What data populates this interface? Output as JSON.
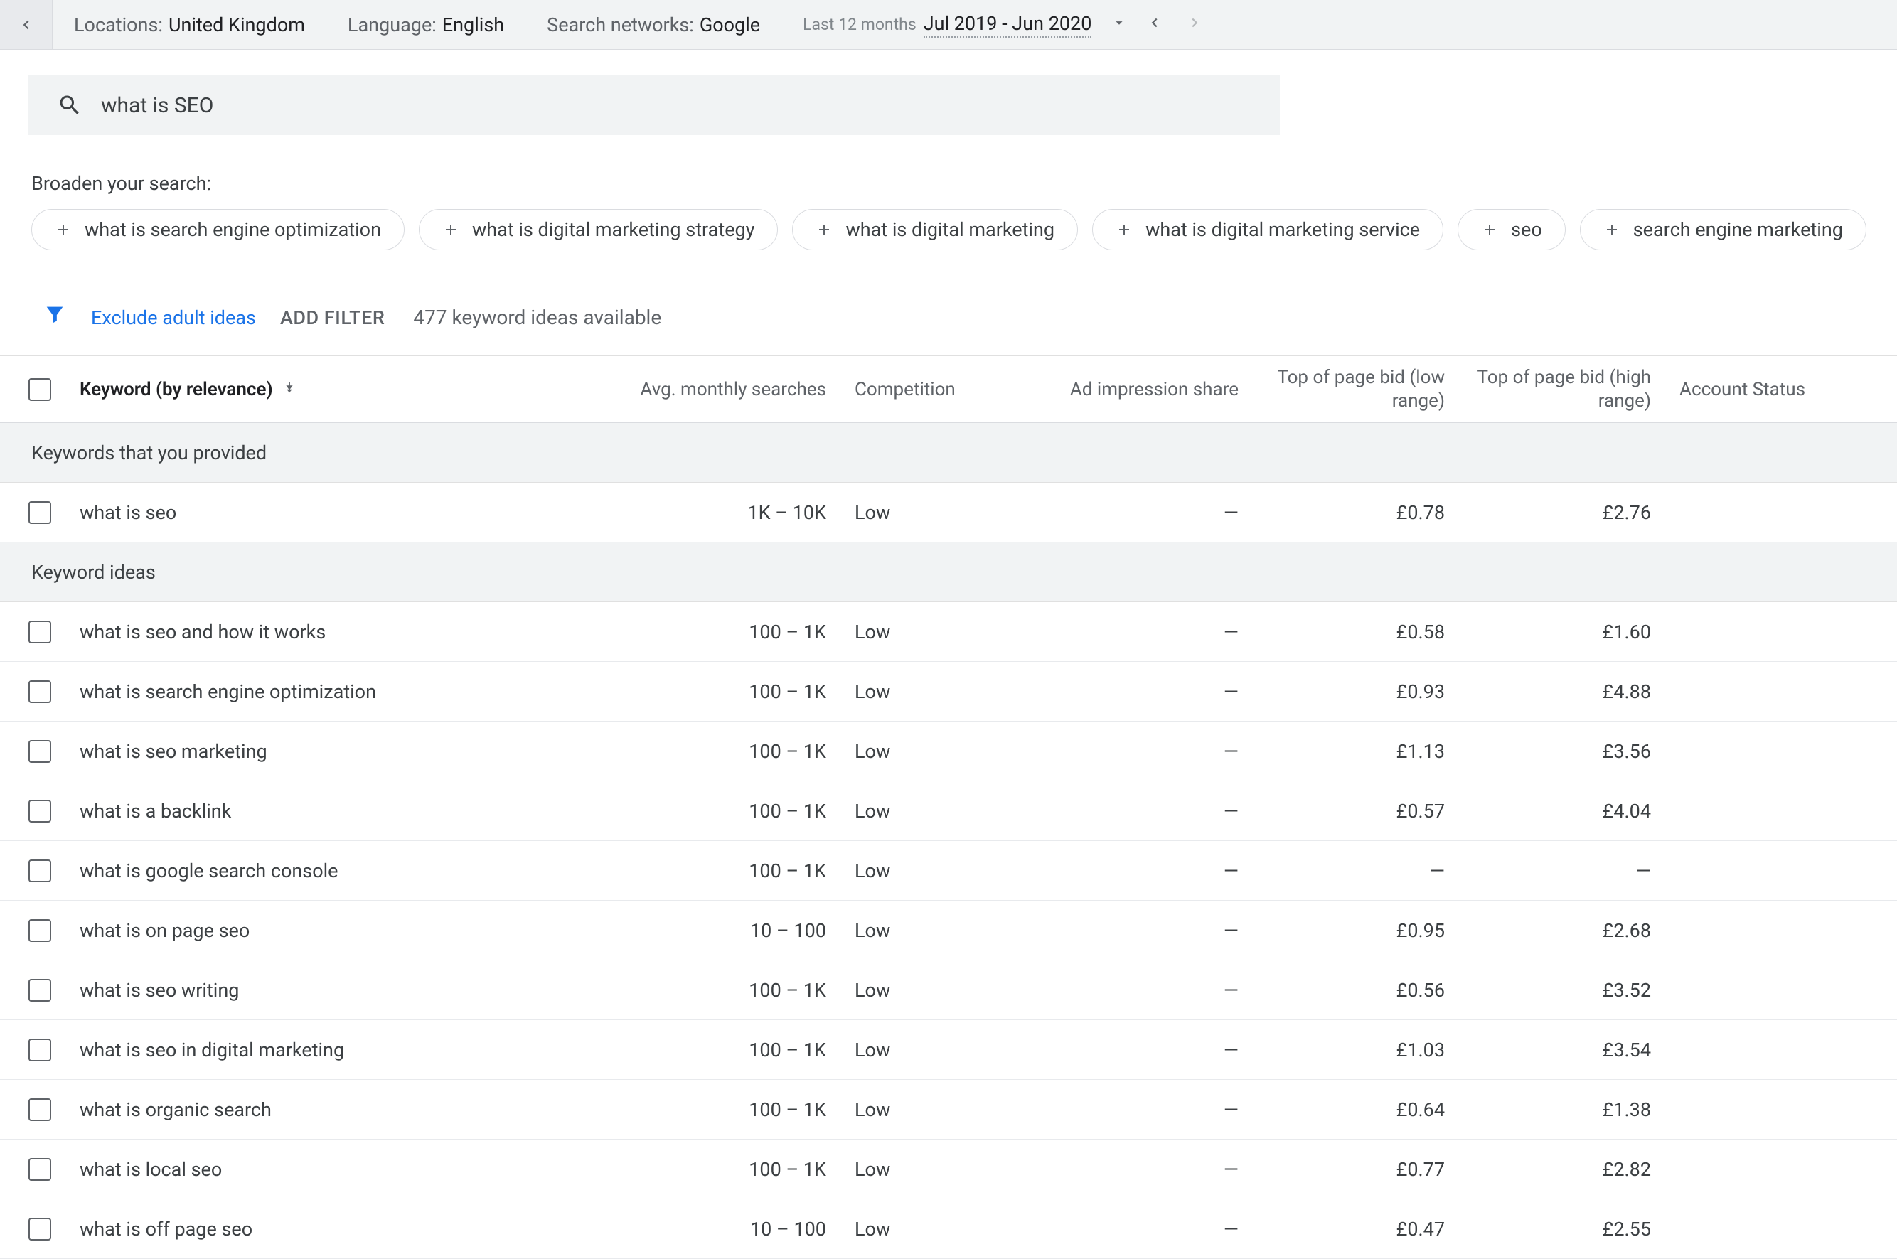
{
  "topbar": {
    "locations_label": "Locations:",
    "locations_value": "United Kingdom",
    "language_label": "Language:",
    "language_value": "English",
    "networks_label": "Search networks:",
    "networks_value": "Google",
    "date_small_label": "Last 12 months",
    "date_value": "Jul 2019 - Jun 2020"
  },
  "search": {
    "query": "what is SEO"
  },
  "broaden": {
    "label": "Broaden your search:",
    "chips": [
      "what is search engine optimization",
      "what is digital marketing strategy",
      "what is digital marketing",
      "what is digital marketing service",
      "seo",
      "search engine marketing"
    ]
  },
  "filters": {
    "exclude_link": "Exclude adult ideas",
    "add_filter": "ADD FILTER",
    "idea_count": "477 keyword ideas available"
  },
  "columns": {
    "keyword": "Keyword (by relevance)",
    "searches": "Avg. monthly searches",
    "competition": "Competition",
    "impression": "Ad impression share",
    "bid_low": "Top of page bid (low range)",
    "bid_high": "Top of page bid (high range)",
    "status": "Account Status"
  },
  "sections": {
    "provided": "Keywords that you provided",
    "ideas": "Keyword ideas"
  },
  "provided_rows": [
    {
      "keyword": "what is seo",
      "searches": "1K – 10K",
      "competition": "Low",
      "impression": "—",
      "bid_low": "£0.78",
      "bid_high": "£2.76"
    }
  ],
  "idea_rows": [
    {
      "keyword": "what is seo and how it works",
      "searches": "100 – 1K",
      "competition": "Low",
      "impression": "—",
      "bid_low": "£0.58",
      "bid_high": "£1.60"
    },
    {
      "keyword": "what is search engine optimization",
      "searches": "100 – 1K",
      "competition": "Low",
      "impression": "—",
      "bid_low": "£0.93",
      "bid_high": "£4.88"
    },
    {
      "keyword": "what is seo marketing",
      "searches": "100 – 1K",
      "competition": "Low",
      "impression": "—",
      "bid_low": "£1.13",
      "bid_high": "£3.56"
    },
    {
      "keyword": "what is a backlink",
      "searches": "100 – 1K",
      "competition": "Low",
      "impression": "—",
      "bid_low": "£0.57",
      "bid_high": "£4.04"
    },
    {
      "keyword": "what is google search console",
      "searches": "100 – 1K",
      "competition": "Low",
      "impression": "—",
      "bid_low": "—",
      "bid_high": "—"
    },
    {
      "keyword": "what is on page seo",
      "searches": "10 – 100",
      "competition": "Low",
      "impression": "—",
      "bid_low": "£0.95",
      "bid_high": "£2.68"
    },
    {
      "keyword": "what is seo writing",
      "searches": "100 – 1K",
      "competition": "Low",
      "impression": "—",
      "bid_low": "£0.56",
      "bid_high": "£3.52"
    },
    {
      "keyword": "what is seo in digital marketing",
      "searches": "100 – 1K",
      "competition": "Low",
      "impression": "—",
      "bid_low": "£1.03",
      "bid_high": "£3.54"
    },
    {
      "keyword": "what is organic search",
      "searches": "100 – 1K",
      "competition": "Low",
      "impression": "—",
      "bid_low": "£0.64",
      "bid_high": "£1.38"
    },
    {
      "keyword": "what is local seo",
      "searches": "100 – 1K",
      "competition": "Low",
      "impression": "—",
      "bid_low": "£0.77",
      "bid_high": "£2.82"
    },
    {
      "keyword": "what is off page seo",
      "searches": "10 – 100",
      "competition": "Low",
      "impression": "—",
      "bid_low": "£0.47",
      "bid_high": "£2.55"
    }
  ]
}
